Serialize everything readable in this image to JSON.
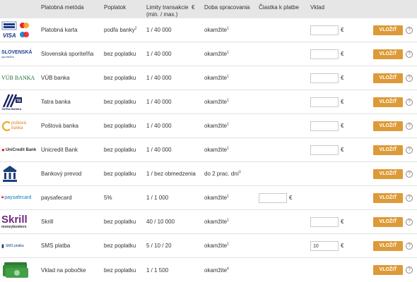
{
  "header": {
    "method": "Platobná metóda",
    "fee": "Poplatok",
    "limits": "Limity transakcie",
    "limits_unit": "€",
    "limits_sub": "(min. / max.)",
    "processing": "Doba spracovania",
    "amount": "Čiastka k platbe",
    "deposit": "Vklad"
  },
  "button_label": "VLOŽIŤ",
  "help_symbol": "?",
  "currency": "€",
  "rows": [
    {
      "logo": "visa-mastercard",
      "name": "Platobná karta",
      "fee": "podľa banky",
      "fee_note": "2",
      "limits": "1 / 40 000",
      "processing": "okamžite",
      "proc_note": "1",
      "deposit_value": "",
      "show_amount": false,
      "show_deposit": true
    },
    {
      "logo": "slovenska-sporitelna",
      "logo_text": "SLOVENSKÁ",
      "logo_text2": "sporiteľňa",
      "name": "Slovenská sporiteľňa",
      "fee": "bez poplatku",
      "fee_note": "",
      "limits": "1 / 40 000",
      "processing": "okamžite",
      "proc_note": "1",
      "deposit_value": "",
      "show_amount": false,
      "show_deposit": true
    },
    {
      "logo": "vub-banka",
      "logo_text": "VÚB BANKA",
      "name": "VÚB banka",
      "fee": "bez poplatku",
      "fee_note": "",
      "limits": "1 / 40 000",
      "processing": "okamžite",
      "proc_note": "1",
      "deposit_value": "",
      "show_amount": false,
      "show_deposit": true
    },
    {
      "logo": "tatra-banka",
      "logo_text": "TATRA BANKA",
      "name": "Tatra banka",
      "fee": "bez poplatku",
      "fee_note": "",
      "limits": "1 / 40 000",
      "processing": "okamžite",
      "proc_note": "1",
      "deposit_value": "",
      "show_amount": false,
      "show_deposit": true
    },
    {
      "logo": "postova-banka",
      "logo_text": "poštová",
      "logo_text2": "banka",
      "name": "Poštová banka",
      "fee": "bez poplatku",
      "fee_note": "",
      "limits": "1 / 40 000",
      "processing": "okamžite",
      "proc_note": "1",
      "deposit_value": "",
      "show_amount": false,
      "show_deposit": true
    },
    {
      "logo": "unicredit-bank",
      "logo_text": "UniCredit Bank",
      "name": "Unicredit Bank",
      "fee": "bez poplatku",
      "fee_note": "",
      "limits": "1 / 40 000",
      "processing": "okamžite",
      "proc_note": "1",
      "deposit_value": "",
      "show_amount": false,
      "show_deposit": true
    },
    {
      "logo": "bank-building",
      "name": "Bankový prevod",
      "fee": "bez poplatku",
      "fee_note": "",
      "limits": "1 / bez obmedzenia",
      "processing": "do 2 prac. dní",
      "proc_note": "3",
      "deposit_value": "",
      "show_amount": false,
      "show_deposit": false
    },
    {
      "logo": "paysafecard",
      "logo_text": "paysafecard",
      "name": "paysafecard",
      "fee": "5%",
      "fee_note": "",
      "limits": "1 / 1 000",
      "processing": "okamžite",
      "proc_note": "1",
      "deposit_value": "",
      "show_amount": true,
      "show_deposit": false
    },
    {
      "logo": "skrill",
      "logo_text": "Skrill",
      "logo_text2": "moneybookers",
      "name": "Skrill",
      "fee": "bez poplatku",
      "fee_note": "",
      "limits": "40 / 10 000",
      "processing": "okamžite",
      "proc_note": "1",
      "deposit_value": "",
      "show_amount": false,
      "show_deposit": true
    },
    {
      "logo": "sms-platba",
      "logo_text": "SMS platba",
      "name": "SMS platba",
      "fee": "bez poplatku",
      "fee_note": "",
      "limits": "5 / 10 / 20",
      "processing": "okamžite",
      "proc_note": "1",
      "deposit_value": "10",
      "show_amount": false,
      "show_deposit": true
    },
    {
      "logo": "cash-banknotes",
      "name": "Vklad na pobočke",
      "fee": "bez poplatku",
      "fee_note": "",
      "limits": "1 / 1 500",
      "processing": "okamžite",
      "proc_note": "4",
      "deposit_value": "",
      "show_amount": false,
      "show_deposit": false
    }
  ]
}
